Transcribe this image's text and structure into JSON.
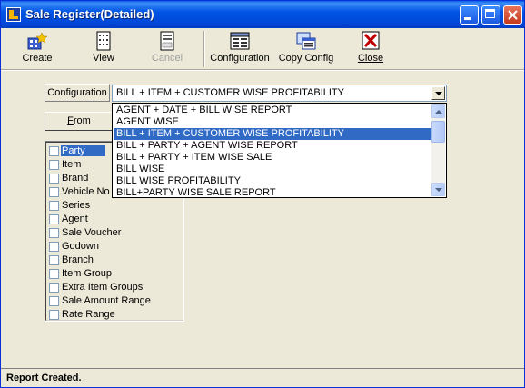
{
  "window": {
    "title": "Sale Register(Detailed)"
  },
  "toolbar": {
    "create_label": "Create",
    "view_label": "View",
    "cancel_label": "Cancel",
    "configuration_label": "Configuration",
    "copy_config_label": "Copy Config",
    "close_label": "Close"
  },
  "config": {
    "label": "Configuration",
    "selected_value": "BILL + ITEM + CUSTOMER WISE PROFITABILITY",
    "options": [
      "AGENT + DATE + BILL WISE REPORT",
      "AGENT WISE",
      "BILL + ITEM + CUSTOMER WISE PROFITABILITY",
      "BILL + PARTY + AGENT WISE REPORT",
      "BILL + PARTY + ITEM WISE SALE",
      "BILL WISE",
      "BILL WISE PROFITABILITY",
      "BILL+PARTY WISE SALE REPORT"
    ]
  },
  "from_button": {
    "label_prefix": "F",
    "label_rest": "rom"
  },
  "filters": [
    "Party",
    "Item",
    "Brand",
    "Vehicle No",
    "Series",
    "Agent",
    "Sale Voucher",
    "Godown",
    "Branch",
    "Item Group",
    "Extra Item Groups",
    "Sale Amount Range",
    "Rate Range"
  ],
  "status": {
    "text": "Report Created."
  },
  "icons": {
    "create": "create-icon",
    "view": "view-icon",
    "cancel": "cancel-icon",
    "configuration": "configuration-icon",
    "copy_config": "copy-config-icon",
    "close": "close-icon"
  },
  "colors": {
    "title_bar": "#0055e5",
    "selection": "#316ac5",
    "window_bg": "#ece9d8"
  }
}
